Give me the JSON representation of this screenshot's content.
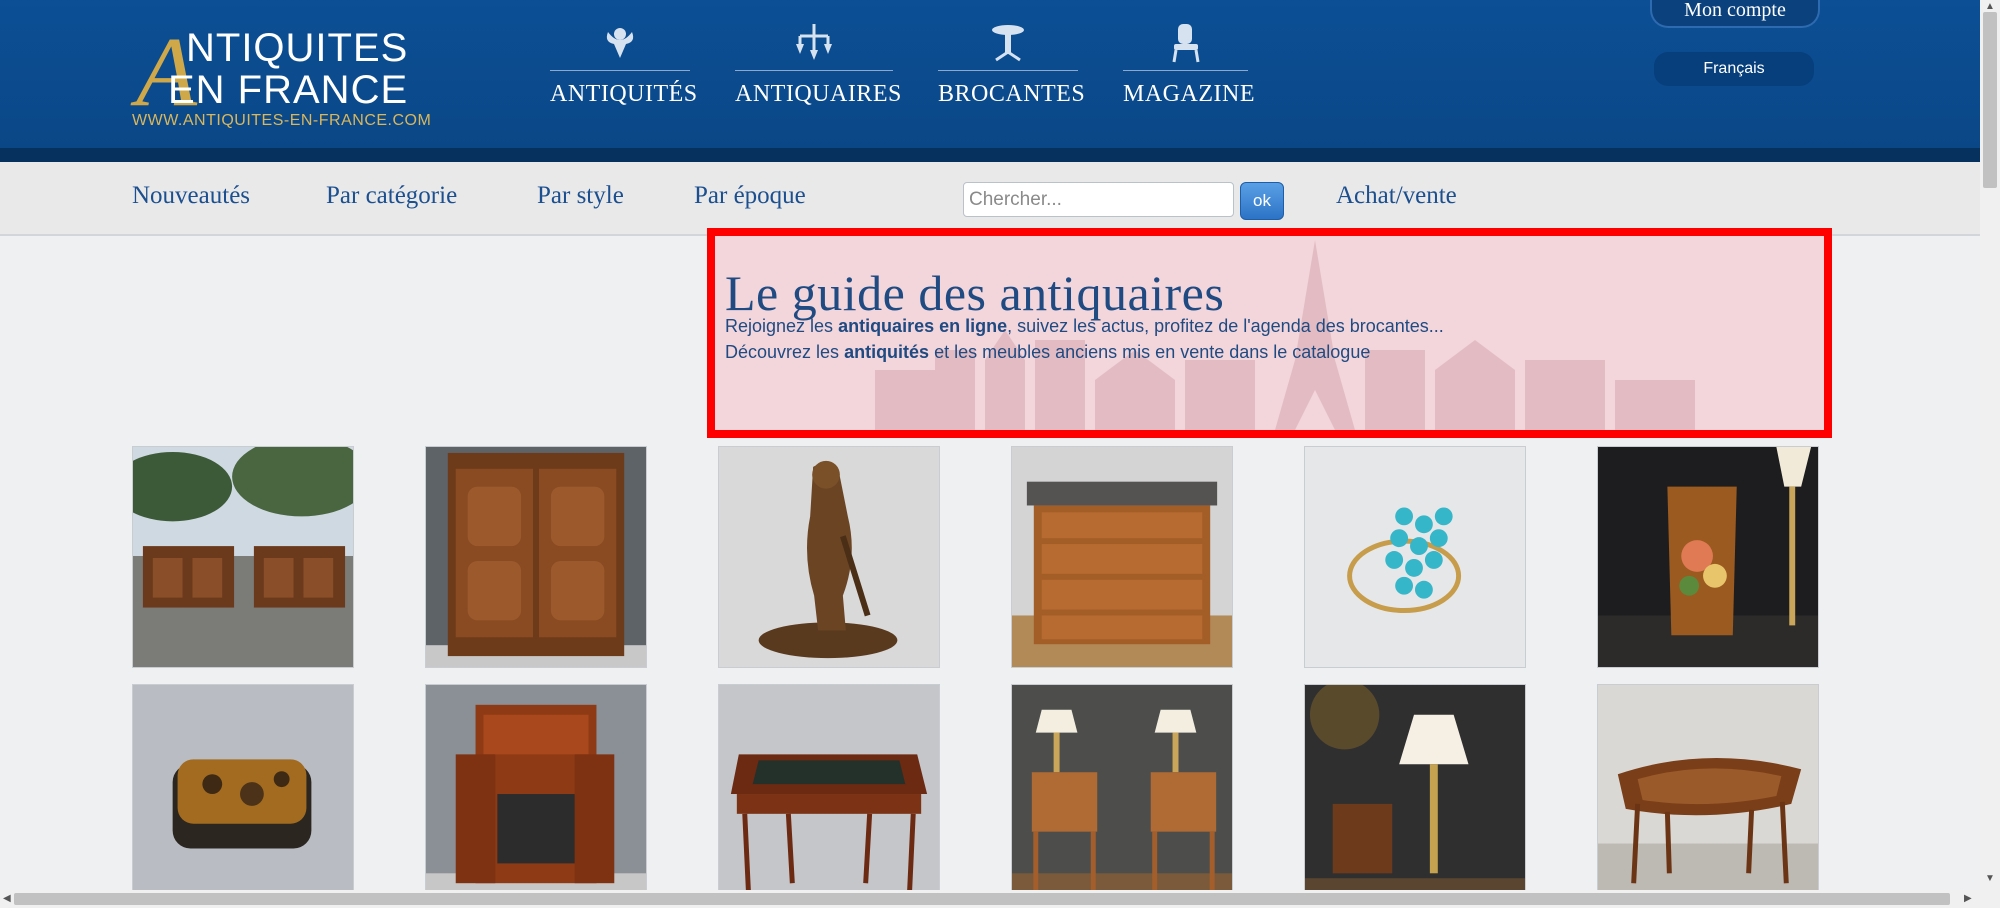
{
  "header": {
    "logo": {
      "letter": "A",
      "line1": "NTIQUITES",
      "line2": "EN FRANCE",
      "url": "WWW.ANTIQUITES-EN-FRANCE.COM"
    },
    "main_nav": [
      {
        "label": "ANTIQUITÉS",
        "icon": "cherub-icon"
      },
      {
        "label": "ANTIQUAIRES",
        "icon": "chandelier-icon"
      },
      {
        "label": "BROCANTES",
        "icon": "table-icon"
      },
      {
        "label": "MAGAZINE",
        "icon": "chair-icon"
      }
    ],
    "account_label": "Mon compte",
    "language": "Français"
  },
  "subnav": {
    "links": [
      "Nouveautés",
      "Par catégorie",
      "Par style",
      "Par époque"
    ],
    "search_placeholder": "Chercher...",
    "search_button": "ok",
    "achat_vente": "Achat/vente"
  },
  "hero": {
    "title": "Le guide des antiquaires",
    "line1": {
      "pre": "Rejoignez les ",
      "bold": "antiquaires en ligne",
      "post": ", suivez les actus, profitez de l'agenda des brocantes..."
    },
    "line2": {
      "pre": "Découvrez les ",
      "bold": "antiquités",
      "post": " et les meubles anciens mis en vente dans le catalogue"
    }
  },
  "products": [
    {
      "name": "pair-of-carved-cabinets"
    },
    {
      "name": "walnut-armoire"
    },
    {
      "name": "bronze-sculpture"
    },
    {
      "name": "marble-top-commode"
    },
    {
      "name": "turquoise-ring"
    },
    {
      "name": "painted-vase-with-lamp"
    },
    {
      "name": "tortoiseshell-box"
    },
    {
      "name": "secretaire-cabinet"
    },
    {
      "name": "leather-top-desk"
    },
    {
      "name": "pair-of-nightstands"
    },
    {
      "name": "lamp-on-table"
    },
    {
      "name": "marquetry-table"
    }
  ]
}
